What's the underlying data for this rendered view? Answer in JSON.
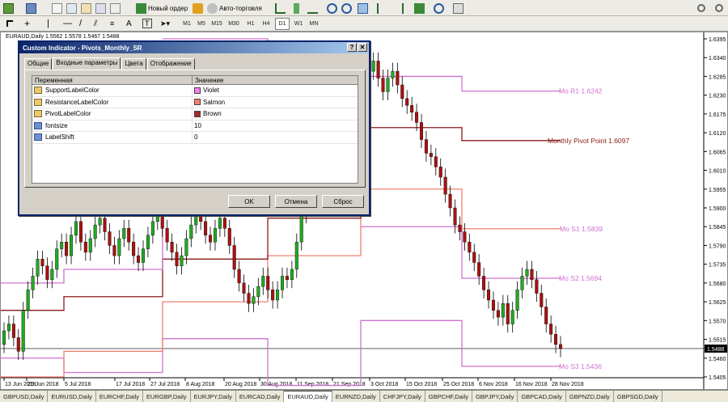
{
  "toolbar": {
    "new_order": "Новый ордер",
    "autotrading": "Авто-торговля",
    "timeframes": [
      "M1",
      "M5",
      "M15",
      "M30",
      "H1",
      "H4",
      "D1",
      "W1",
      "MN"
    ],
    "active_timeframe": "D1"
  },
  "chart": {
    "info": "EURAUD,Daily  1.5562 1.5578 1.5467 1.5488",
    "current_price": "1.5488",
    "price_ticks": [
      "1.6395",
      "1.6340",
      "1.6285",
      "1.6230",
      "1.6175",
      "1.6120",
      "1.6065",
      "1.6010",
      "1.5955",
      "1.5900",
      "1.5845",
      "1.5790",
      "1.5735",
      "1.5680",
      "1.5625",
      "1.5570",
      "1.5515",
      "1.5460",
      "1.5405"
    ],
    "date_ticks": [
      "13 Jun 2018",
      "25 Jun 2018",
      "5 Jul 2018",
      "17 Jul 2018",
      "27 Jul 2018",
      "8 Aug 2018",
      "20 Aug 2018",
      "30 Aug 2018",
      "11 Sep 2018",
      "21 Sep 2018",
      "3 Oct 2018",
      "15 Oct 2018",
      "25 Oct 2018",
      "6 Nov 2018",
      "16 Nov 2018",
      "28 Nov 2018"
    ],
    "level_labels": {
      "r1": "Mo R1  1.6242",
      "pp": "Monthly Pivot Point  1.6097",
      "s1": "Mo S1  1.5839",
      "s2": "Mo S2  1.5694",
      "s3": "Mo S3  1.5436"
    },
    "colors": {
      "support": "#d070d0",
      "resistance": "#f08070",
      "pivot": "#8b1a1a",
      "bull": "#22aa22",
      "bear": "#aa1111"
    }
  },
  "dialog": {
    "title": "Custom Indicator - Pivots_Monthly_SR",
    "help": "?",
    "close": "✕",
    "tabs": [
      "Общие",
      "Входные параметры",
      "Цвета",
      "Отображение"
    ],
    "active_tab": "Входные параметры",
    "columns": [
      "Переменная",
      "Значение"
    ],
    "params": [
      {
        "name": "SupportLabelColor",
        "value": "Violet",
        "color": "#ee82ee",
        "kind": "color"
      },
      {
        "name": "ResistanceLabelColor",
        "value": "Salmon",
        "color": "#fa8072",
        "kind": "color"
      },
      {
        "name": "PivotLabelColor",
        "value": "Brown",
        "color": "#a52a2a",
        "kind": "color"
      },
      {
        "name": "fontsize",
        "value": "10",
        "kind": "int"
      },
      {
        "name": "LabelShift",
        "value": "0",
        "kind": "int"
      }
    ],
    "buttons": {
      "ok": "OK",
      "cancel": "Отмена",
      "reset": "Сброс"
    }
  },
  "symbol_tabs": [
    "GBPUSD,Daily",
    "EURUSD,Daily",
    "EURCHF,Daily",
    "EURGBP,Daily",
    "EURJPY,Daily",
    "EURCAD,Daily",
    "EURAUD,Daily",
    "EURNZD,Daily",
    "CHFJPY,Daily",
    "GBPCHF,Daily",
    "GBPJPY,Daily",
    "GBPCAD,Daily",
    "GBPNZD,Daily",
    "GBPSGD,Daily"
  ],
  "active_symbol_tab": "EURAUD,Daily"
}
